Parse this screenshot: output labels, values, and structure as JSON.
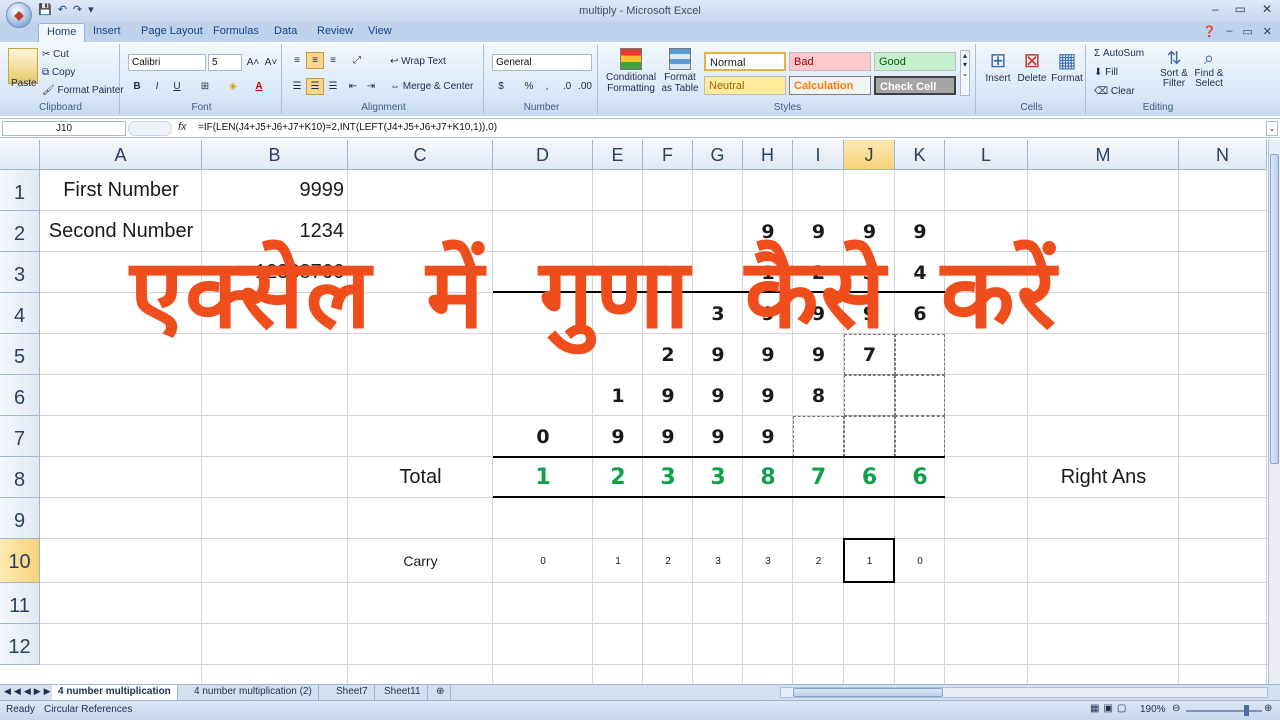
{
  "window": {
    "title": "multiply - Microsoft Excel",
    "controls": [
      "–",
      "▭",
      "✕"
    ]
  },
  "qat": [
    "💾",
    "↶",
    "↷",
    "▾"
  ],
  "tabs": [
    "Home",
    "Insert",
    "Page Layout",
    "Formulas",
    "Data",
    "Review",
    "View"
  ],
  "ribbon": {
    "clipboard": {
      "label": "Clipboard",
      "paste": "Paste",
      "cut": "Cut",
      "copy": "Copy",
      "painter": "Format Painter"
    },
    "font": {
      "label": "Font",
      "name": "Calibri",
      "size": "5",
      "bold": "B",
      "italic": "I",
      "underline": "U"
    },
    "alignment": {
      "label": "Alignment",
      "wrap": "Wrap Text",
      "merge": "Merge & Center"
    },
    "number": {
      "label": "Number",
      "format": "General",
      "currency": "$",
      "percent": "%",
      "comma": ","
    },
    "styles": {
      "label": "Styles",
      "conditional": "Conditional Formatting",
      "format_table": "Format as Table",
      "normal": "Normal",
      "bad": "Bad",
      "good": "Good",
      "neutral": "Neutral",
      "calculation": "Calculation",
      "check": "Check Cell"
    },
    "cells": {
      "label": "Cells",
      "insert": "Insert",
      "delete": "Delete",
      "format": "Format"
    },
    "editing": {
      "label": "Editing",
      "autosum": "AutoSum",
      "fill": "Fill",
      "clear": "Clear",
      "sort": "Sort & Filter",
      "find": "Find & Select"
    }
  },
  "formula_bar": {
    "name_box": "J10",
    "fx": "fx",
    "formula": "=IF(LEN(J4+J5+J6+J7+K10)=2,INT(LEFT(J4+J5+J6+J7+K10,1)),0)"
  },
  "columns": [
    "A",
    "B",
    "C",
    "D",
    "E",
    "F",
    "G",
    "H",
    "I",
    "J",
    "K",
    "L",
    "M",
    "N"
  ],
  "rows": [
    "1",
    "2",
    "3",
    "4",
    "5",
    "6",
    "7",
    "8",
    "9",
    "10",
    "11",
    "12"
  ],
  "cells": {
    "a1": "First Number",
    "b1": "9999",
    "a2": "Second Number",
    "b2": "1234",
    "b3": "12338766",
    "h2": "9",
    "i2": "9",
    "j2": "9",
    "k2": "9",
    "h3": "1",
    "i3": "2",
    "j3": "3",
    "k3": "4",
    "g4": "3",
    "h4": "9",
    "i4": "9",
    "j4": "9",
    "k4": "6",
    "f5": "2",
    "g5": "9",
    "h5": "9",
    "i5": "9",
    "j5": "7",
    "e6": "1",
    "f6": "9",
    "g6": "9",
    "h6": "9",
    "i6": "8",
    "d7": "0",
    "e7": "9",
    "f7": "9",
    "g7": "9",
    "h7": "9",
    "c8": "Total",
    "d8": "1",
    "e8": "2",
    "f8": "3",
    "g8": "3",
    "h8": "8",
    "i8": "7",
    "j8": "6",
    "k8": "6",
    "m8": "Right Ans",
    "c10": "Carry",
    "d10": "0",
    "e10": "1",
    "f10": "2",
    "g10": "3",
    "h10": "3",
    "i10": "2",
    "j10": "1",
    "k10": "0"
  },
  "overlay_title": "एक्सेल में गुणा कैसे करें",
  "sheets": [
    "4 number multiplication",
    "4 number multiplication (2)",
    "Sheet7",
    "Sheet11"
  ],
  "status": {
    "ready": "Ready",
    "circular": "Circular References",
    "zoom": "190%"
  },
  "colors": {
    "overlay": "#f04d1c",
    "total_green": "#0fa14a"
  }
}
